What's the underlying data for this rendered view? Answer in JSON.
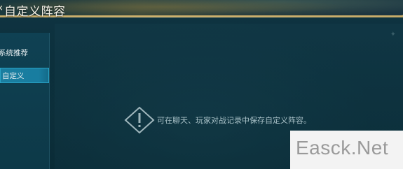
{
  "header": {
    "title": "自定义阵容",
    "back_icon": "back-arrow-icon"
  },
  "sidebar": {
    "items": [
      {
        "label": "系统推荐",
        "selected": false
      },
      {
        "label": "自定义",
        "selected": true
      }
    ]
  },
  "main": {
    "empty_state": {
      "icon": "warning-diamond-icon",
      "message": "可在聊天、玩家对战记录中保存自定义阵容。"
    }
  },
  "watermark": {
    "text": "Easck.Net"
  },
  "colors": {
    "accent_gold": "#c9ad6a",
    "selected_tab": "#1a7ea0",
    "background": "#0c2f3c"
  }
}
